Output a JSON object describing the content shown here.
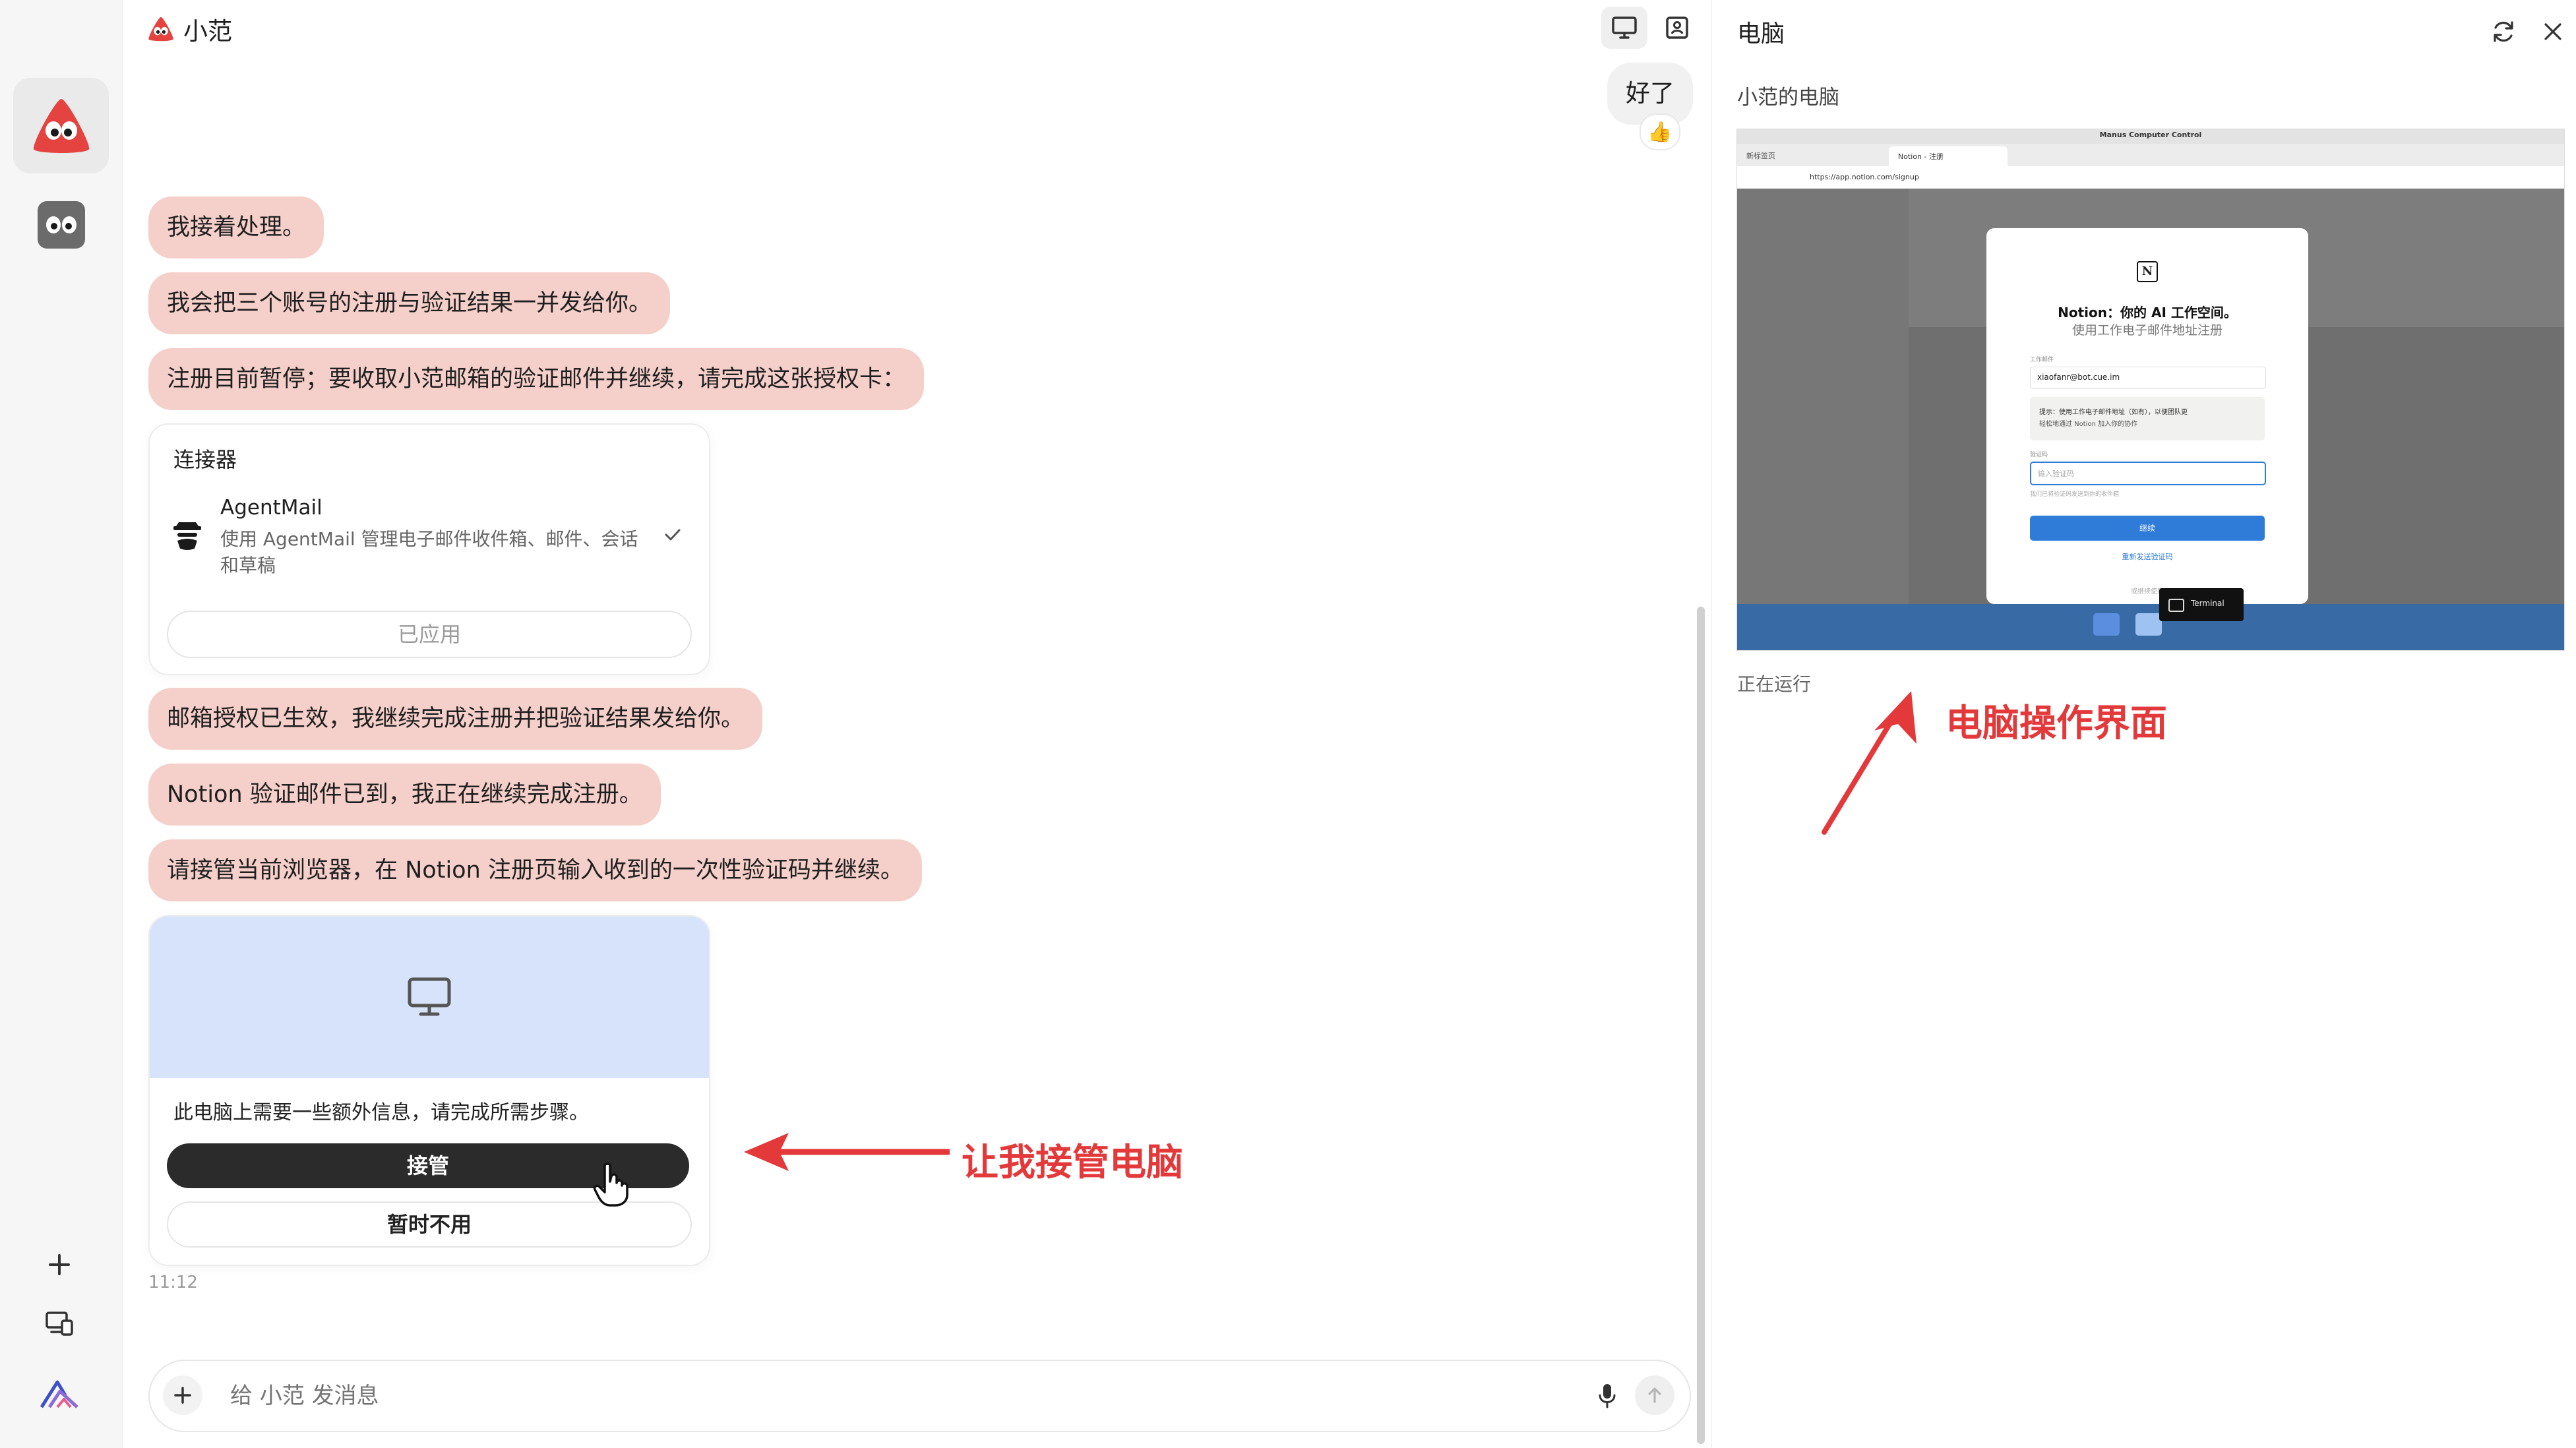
{
  "header": {
    "app_title": "小范"
  },
  "chat": {
    "user_message": "好了",
    "user_reaction": "👍",
    "messages": [
      "我接着处理。",
      "我会把三个账号的注册与验证结果一并发给你。",
      "注册目前暂停；要收取小范邮箱的验证邮件并继续，请完成这张授权卡：",
      "邮箱授权已生效，我继续完成注册并把验证结果发给你。",
      "Notion 验证邮件已到，我正在继续完成注册。",
      "请接管当前浏览器，在 Notion 注册页输入收到的一次性验证码并继续。"
    ],
    "connector_card": {
      "title": "连接器",
      "name": "AgentMail",
      "description_line1": "使用 AgentMail 管理电子邮件收件箱、邮件、会话",
      "description_line2": "和草稿",
      "applied_label": "已应用"
    },
    "takeover_card": {
      "info_text": "此电脑上需要一些额外信息，请完成所需步骤。",
      "takeover_label": "接管",
      "decline_label": "暂时不用"
    },
    "timestamp": "11:12"
  },
  "composer": {
    "placeholder": "给 小范 发消息"
  },
  "panel": {
    "title": "电脑",
    "computer_name": "小范的电脑",
    "status": "正在运行",
    "screen": {
      "window_title": "Manus Computer Control",
      "tab1": "新标签页",
      "tab2": "Notion - 注册",
      "url": "https://app.notion.com/signup",
      "notion_title": "Notion：你的 AI 工作空间。",
      "notion_subtitle": "使用工作电子邮件地址注册",
      "email_label": "工作邮件",
      "email_value": "xiaofanr@bot.cue.im",
      "tip_line1": "提示：使用工作电子邮件地址（如有），以便团队更",
      "tip_line2": "轻松地通过 Notion 加入你的协作",
      "code_label": "验证码",
      "code_placeholder": "输入验证码",
      "code_hint": "我们已将验证码发送到你的收件箱",
      "continue_label": "继续",
      "resend_label": "重新发送验证码",
      "other_label": "或继续使用",
      "terminal_label": "Terminal"
    }
  },
  "annotations": {
    "takeover_note": "让我接管电脑",
    "screen_note": "电脑操作界面"
  },
  "colors": {
    "bubble": "#f5cfc9",
    "annotation": "#e3393b",
    "takeover_button": "#2b2b2b",
    "takeover_banner": "#d6e3fa",
    "notion_blue": "#2f7bd8"
  }
}
